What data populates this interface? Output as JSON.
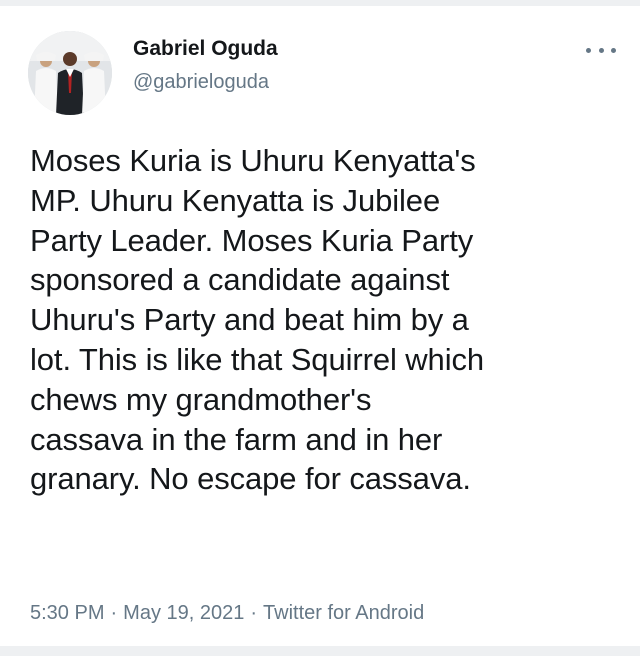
{
  "author": {
    "name": "Gabriel Oguda",
    "handle": "@gabrieloguda",
    "avatar_icon": "profile-photo-icon"
  },
  "menu": {
    "more_icon": "more-horizontal-icon"
  },
  "tweet": {
    "text": "Moses Kuria is Uhuru Kenyatta's\nMP. Uhuru Kenyatta is Jubilee\nParty Leader. Moses Kuria Party\nsponsored a candidate against\nUhuru's Party and beat him by a\nlot. This is like that Squirrel which\nchews my grandmother's\ncassava in the farm and in her\ngranary. No escape for cassava."
  },
  "meta": {
    "time": "5:30 PM",
    "separator": "·",
    "date": "May 19, 2021",
    "source": "Twitter for Android"
  },
  "colors": {
    "text": "#14171a",
    "secondary": "#657786",
    "border": "#eef0f2"
  }
}
